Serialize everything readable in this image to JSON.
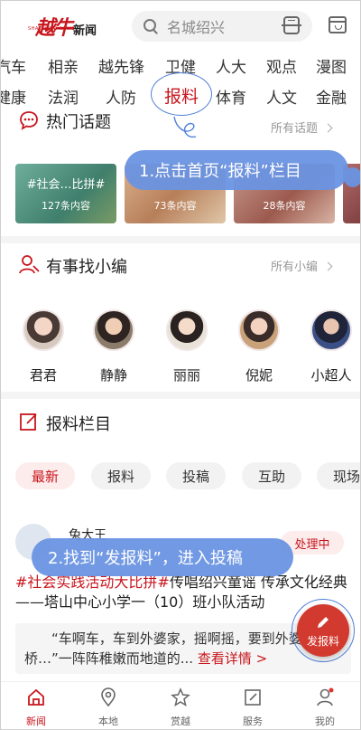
{
  "header": {
    "logo_main": "越牛",
    "logo_news": "新闻",
    "logo_sub": "SHAO XING NEWS",
    "search_placeholder": "名城绍兴"
  },
  "channels_row1": [
    "汽车",
    "相亲",
    "越先锋",
    "卫健",
    "人大",
    "观点",
    "漫图"
  ],
  "channels_row2": [
    "健康",
    "法润",
    "人防",
    "报料",
    "体育",
    "人文",
    "金融"
  ],
  "hot_topics": {
    "title": "热门话题",
    "more": "所有话题",
    "cards": [
      {
        "label": "#社会…比拼#",
        "count": "127条内容"
      },
      {
        "label": "",
        "count": "73条内容"
      },
      {
        "label": "",
        "count": "28条内容"
      },
      {
        "label": "",
        "count": ""
      }
    ]
  },
  "tip1": "1.点击首页“报料”栏目",
  "editors": {
    "title": "有事找小编",
    "more": "所有小编",
    "items": [
      {
        "name": "君君"
      },
      {
        "name": "静静"
      },
      {
        "name": "丽丽"
      },
      {
        "name": "倪妮"
      },
      {
        "name": "小超人"
      }
    ]
  },
  "report": {
    "title": "报料栏目",
    "tabs": [
      "最新",
      "报料",
      "投稿",
      "互助",
      "现场"
    ]
  },
  "post": {
    "user": "兔大王",
    "status": "处理中",
    "tag": "#社会实践活动大比拼#",
    "text": "传唱绍兴童谣 传承文化经典——塔山中心小学一（10）班小队活动",
    "quote": "“车啊车，车到外婆家，摇啊摇，要到外婆桥…”一阵阵稚嫩而地道的...",
    "quote_more": "查看详情 >"
  },
  "tip2": "2.找到“发报料”，进入投稿",
  "fab_label": "发报料",
  "bottom_nav": [
    "新闻",
    "本地",
    "赏越",
    "服务",
    "我的"
  ],
  "colors": {
    "brand": "#c8161d",
    "tip": "#6a94e2"
  }
}
